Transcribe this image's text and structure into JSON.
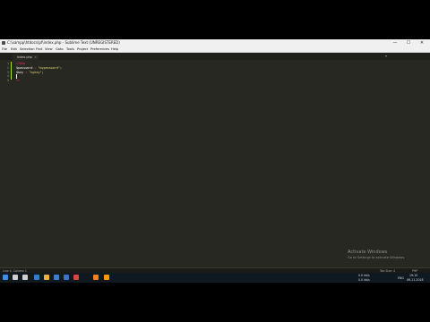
{
  "window": {
    "title": "C:\\xampp\\htdocs\\pf\\index.php - Sublime Text (UNREGISTERED)",
    "controls": {
      "minimize": "—",
      "maximize": "☐",
      "close": "✕"
    }
  },
  "menu": [
    "File",
    "Edit",
    "Selection",
    "Find",
    "View",
    "Goto",
    "Tools",
    "Project",
    "Preferences",
    "Help"
  ],
  "tabs": [
    {
      "label": "index.php",
      "close": "×"
    }
  ],
  "tab_dropdown": "▾",
  "editor": {
    "line_numbers": [
      "1",
      "2",
      "3",
      "4",
      "5"
    ],
    "lines": [
      {
        "tokens": [
          {
            "text": "<?php",
            "cls": "c-kw"
          }
        ]
      },
      {
        "tokens": [
          {
            "text": "$password",
            "cls": "c-var"
          },
          {
            "text": " = ",
            "cls": "c-op"
          },
          {
            "text": "\"mypassword\"",
            "cls": "c-str"
          },
          {
            "text": ";",
            "cls": "c-punc"
          }
        ]
      },
      {
        "tokens": [
          {
            "text": "$key",
            "cls": "c-var"
          },
          {
            "text": " = ",
            "cls": "c-op"
          },
          {
            "text": "\"mykey\"",
            "cls": "c-str"
          },
          {
            "text": ";",
            "cls": "c-punc"
          }
        ]
      },
      {
        "tokens": []
      },
      {
        "tokens": [
          {
            "text": "?>",
            "cls": "c-kw"
          }
        ]
      }
    ],
    "cursor_line": 4
  },
  "watermark": {
    "title": "Activate Windows",
    "subtitle": "Go to Settings to activate Windows."
  },
  "status": {
    "left": "Line 4, Column 1",
    "tab_size": "Tab Size: 4",
    "syntax": "PHP"
  },
  "taskbar": {
    "icons": [
      {
        "name": "windows-start-icon",
        "color": "#3a8ee6"
      },
      {
        "name": "search-icon",
        "color": "#cfcfcf"
      },
      {
        "name": "task-view-icon",
        "color": "#cfcfcf"
      },
      {
        "name": "edge-icon",
        "color": "#2f7fd1"
      },
      {
        "name": "file-explorer-icon",
        "color": "#e8b33c"
      },
      {
        "name": "store-icon",
        "color": "#3c7fd1"
      },
      {
        "name": "mail-icon",
        "color": "#3a73c9"
      },
      {
        "name": "chrome-icon",
        "color": "#d9473a"
      },
      {
        "name": "xampp-icon",
        "color": "#f27f2a"
      },
      {
        "name": "sublime-icon",
        "color": "#ff9800"
      }
    ],
    "tray_temp": "0.0 kb/s",
    "tray_temp2": "0.0 kb/s",
    "lang": "ENG",
    "time": "19:10",
    "date": "06-11-2018"
  }
}
